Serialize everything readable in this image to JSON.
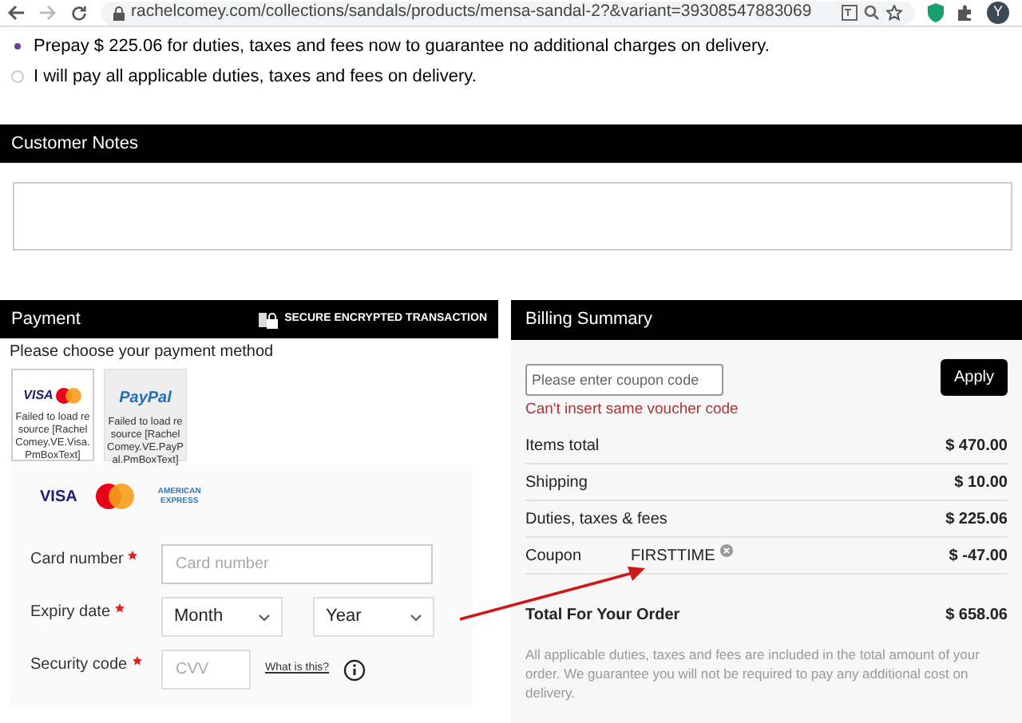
{
  "browser": {
    "url": "rachelcomey.com/collections/sandals/products/mensa-sandal-2?&variant=39308547883069",
    "avatar": "Y"
  },
  "duties_options": [
    {
      "label": "Prepay $ 225.06 for duties, taxes and fees now to guarantee no additional charges on delivery.",
      "selected": true
    },
    {
      "label": "I will pay all applicable duties, taxes and fees on delivery.",
      "selected": false
    }
  ],
  "customer_notes": {
    "title": "Customer Notes"
  },
  "payment": {
    "title": "Payment",
    "secure_label": "SECURE ENCRYPTED TRANSACTION",
    "prompt": "Please choose your payment method",
    "methods": [
      {
        "kind": "visa-mastercard",
        "caption": "Failed to load resource [Rachel Comey.VE.Visa.PmBoxText]",
        "selected": true
      },
      {
        "kind": "paypal",
        "caption": "Failed to load resource [Rachel Comey.VE.PayPal.PmBoxText]",
        "selected": false
      }
    ],
    "paypal_logo": "PayPal",
    "card_visa_logo": "VISA",
    "visa_logo": "VISA",
    "amex_logo": "AMERICAN EXPRESS",
    "fields": [
      {
        "kind": "text",
        "label": "Card number",
        "placeholder": "Card number"
      },
      {
        "kind": "expiry",
        "label": "Expiry date",
        "month": "Month",
        "year": "Year"
      },
      {
        "kind": "cvv",
        "label": "Security code",
        "placeholder": "CVV",
        "help_link": "What is this?"
      }
    ]
  },
  "billing": {
    "title": "Billing Summary",
    "coupon_placeholder": "Please enter coupon code",
    "apply": "Apply",
    "error": "Can't insert same voucher code",
    "rows": [
      {
        "label": "Items total",
        "amount": "$ 470.00"
      },
      {
        "label": "Shipping",
        "amount": "$ 10.00"
      },
      {
        "label": "Duties, taxes & fees",
        "amount": "$ 225.06"
      },
      {
        "label": "Coupon",
        "code": "FIRSTTIME",
        "amount": "$ -47.00"
      }
    ],
    "total_label": "Total For Your Order",
    "total": "$ 658.06",
    "note": "All applicable duties, taxes and fees are included in the total amount of your order. We guarantee you will not be required to pay any additional cost on delivery."
  }
}
